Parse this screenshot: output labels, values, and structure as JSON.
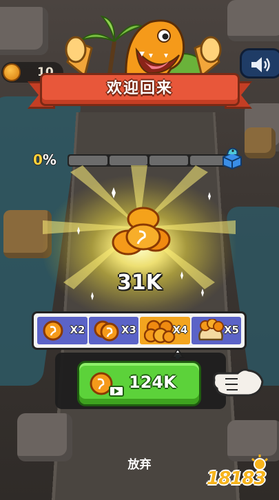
{
  "hud": {
    "coin_value": "10"
  },
  "banner": {
    "title": "欢迎回来"
  },
  "progress": {
    "percent_label": "0",
    "percent_sign": "%",
    "fraction": 0,
    "segments": 4
  },
  "reward": {
    "amount": "31K"
  },
  "multipliers": [
    {
      "label": "X2",
      "selected": false
    },
    {
      "label": "X3",
      "selected": false
    },
    {
      "label": "X4",
      "selected": true
    },
    {
      "label": "X5",
      "selected": false
    }
  ],
  "claim": {
    "amount": "124K",
    "icon": "video-ad-icon"
  },
  "give_up": {
    "label": "放弃"
  },
  "watermark": {
    "text": "18183"
  },
  "colors": {
    "banner": "#e8573a",
    "claim": "#5cd23a",
    "multiplier": "#5b63c7",
    "multiplier_active": "#f3a51f",
    "coin": "#f59a1a"
  }
}
